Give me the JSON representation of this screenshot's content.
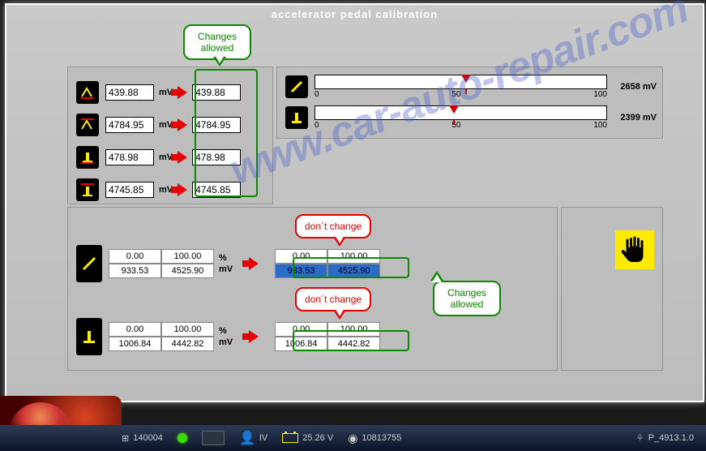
{
  "title": "accelerator pedal calibration",
  "callouts": {
    "changes_allowed": "Changes\nallowed",
    "dont_change": "don´t change"
  },
  "panelA": {
    "rows": [
      {
        "readout": "439.88",
        "unit": "mV",
        "edit": "439.88"
      },
      {
        "readout": "4784.95",
        "unit": "mV",
        "edit": "4784.95"
      },
      {
        "readout": "478.98",
        "unit": "mV",
        "edit": "478.98"
      },
      {
        "readout": "4745.85",
        "unit": "mV",
        "edit": "4745.85"
      }
    ]
  },
  "panelB": {
    "sliders": [
      {
        "value_label": "2658 mV",
        "pos_pct": 50,
        "scale": [
          "0",
          "50",
          "100"
        ]
      },
      {
        "value_label": "2399 mV",
        "pos_pct": 46,
        "scale": [
          "0",
          "50",
          "100"
        ]
      }
    ]
  },
  "panelC": {
    "groups": [
      {
        "left": {
          "r1": [
            "0.00",
            "100.00"
          ],
          "r2": [
            "933.53",
            "4525.90"
          ],
          "u1": "%",
          "u2": "mV"
        },
        "right": {
          "r1": [
            "0.00",
            "100.00"
          ],
          "r2": [
            "933.53",
            "4525.90"
          ],
          "highlight": true
        }
      },
      {
        "left": {
          "r1": [
            "0.00",
            "100.00"
          ],
          "r2": [
            "1006.84",
            "4442.82"
          ],
          "u1": "%",
          "u2": "mV"
        },
        "right": {
          "r1": [
            "0.00",
            "100.00"
          ],
          "r2": [
            "1006.84",
            "4442.82"
          ],
          "highlight": false
        }
      }
    ]
  },
  "taskbar": {
    "code": "140004",
    "level": "IV",
    "voltage": "25.26 V",
    "odometer": "10813755",
    "program": "P_4913.1.0"
  },
  "watermark": "www.car-auto-repair.com"
}
